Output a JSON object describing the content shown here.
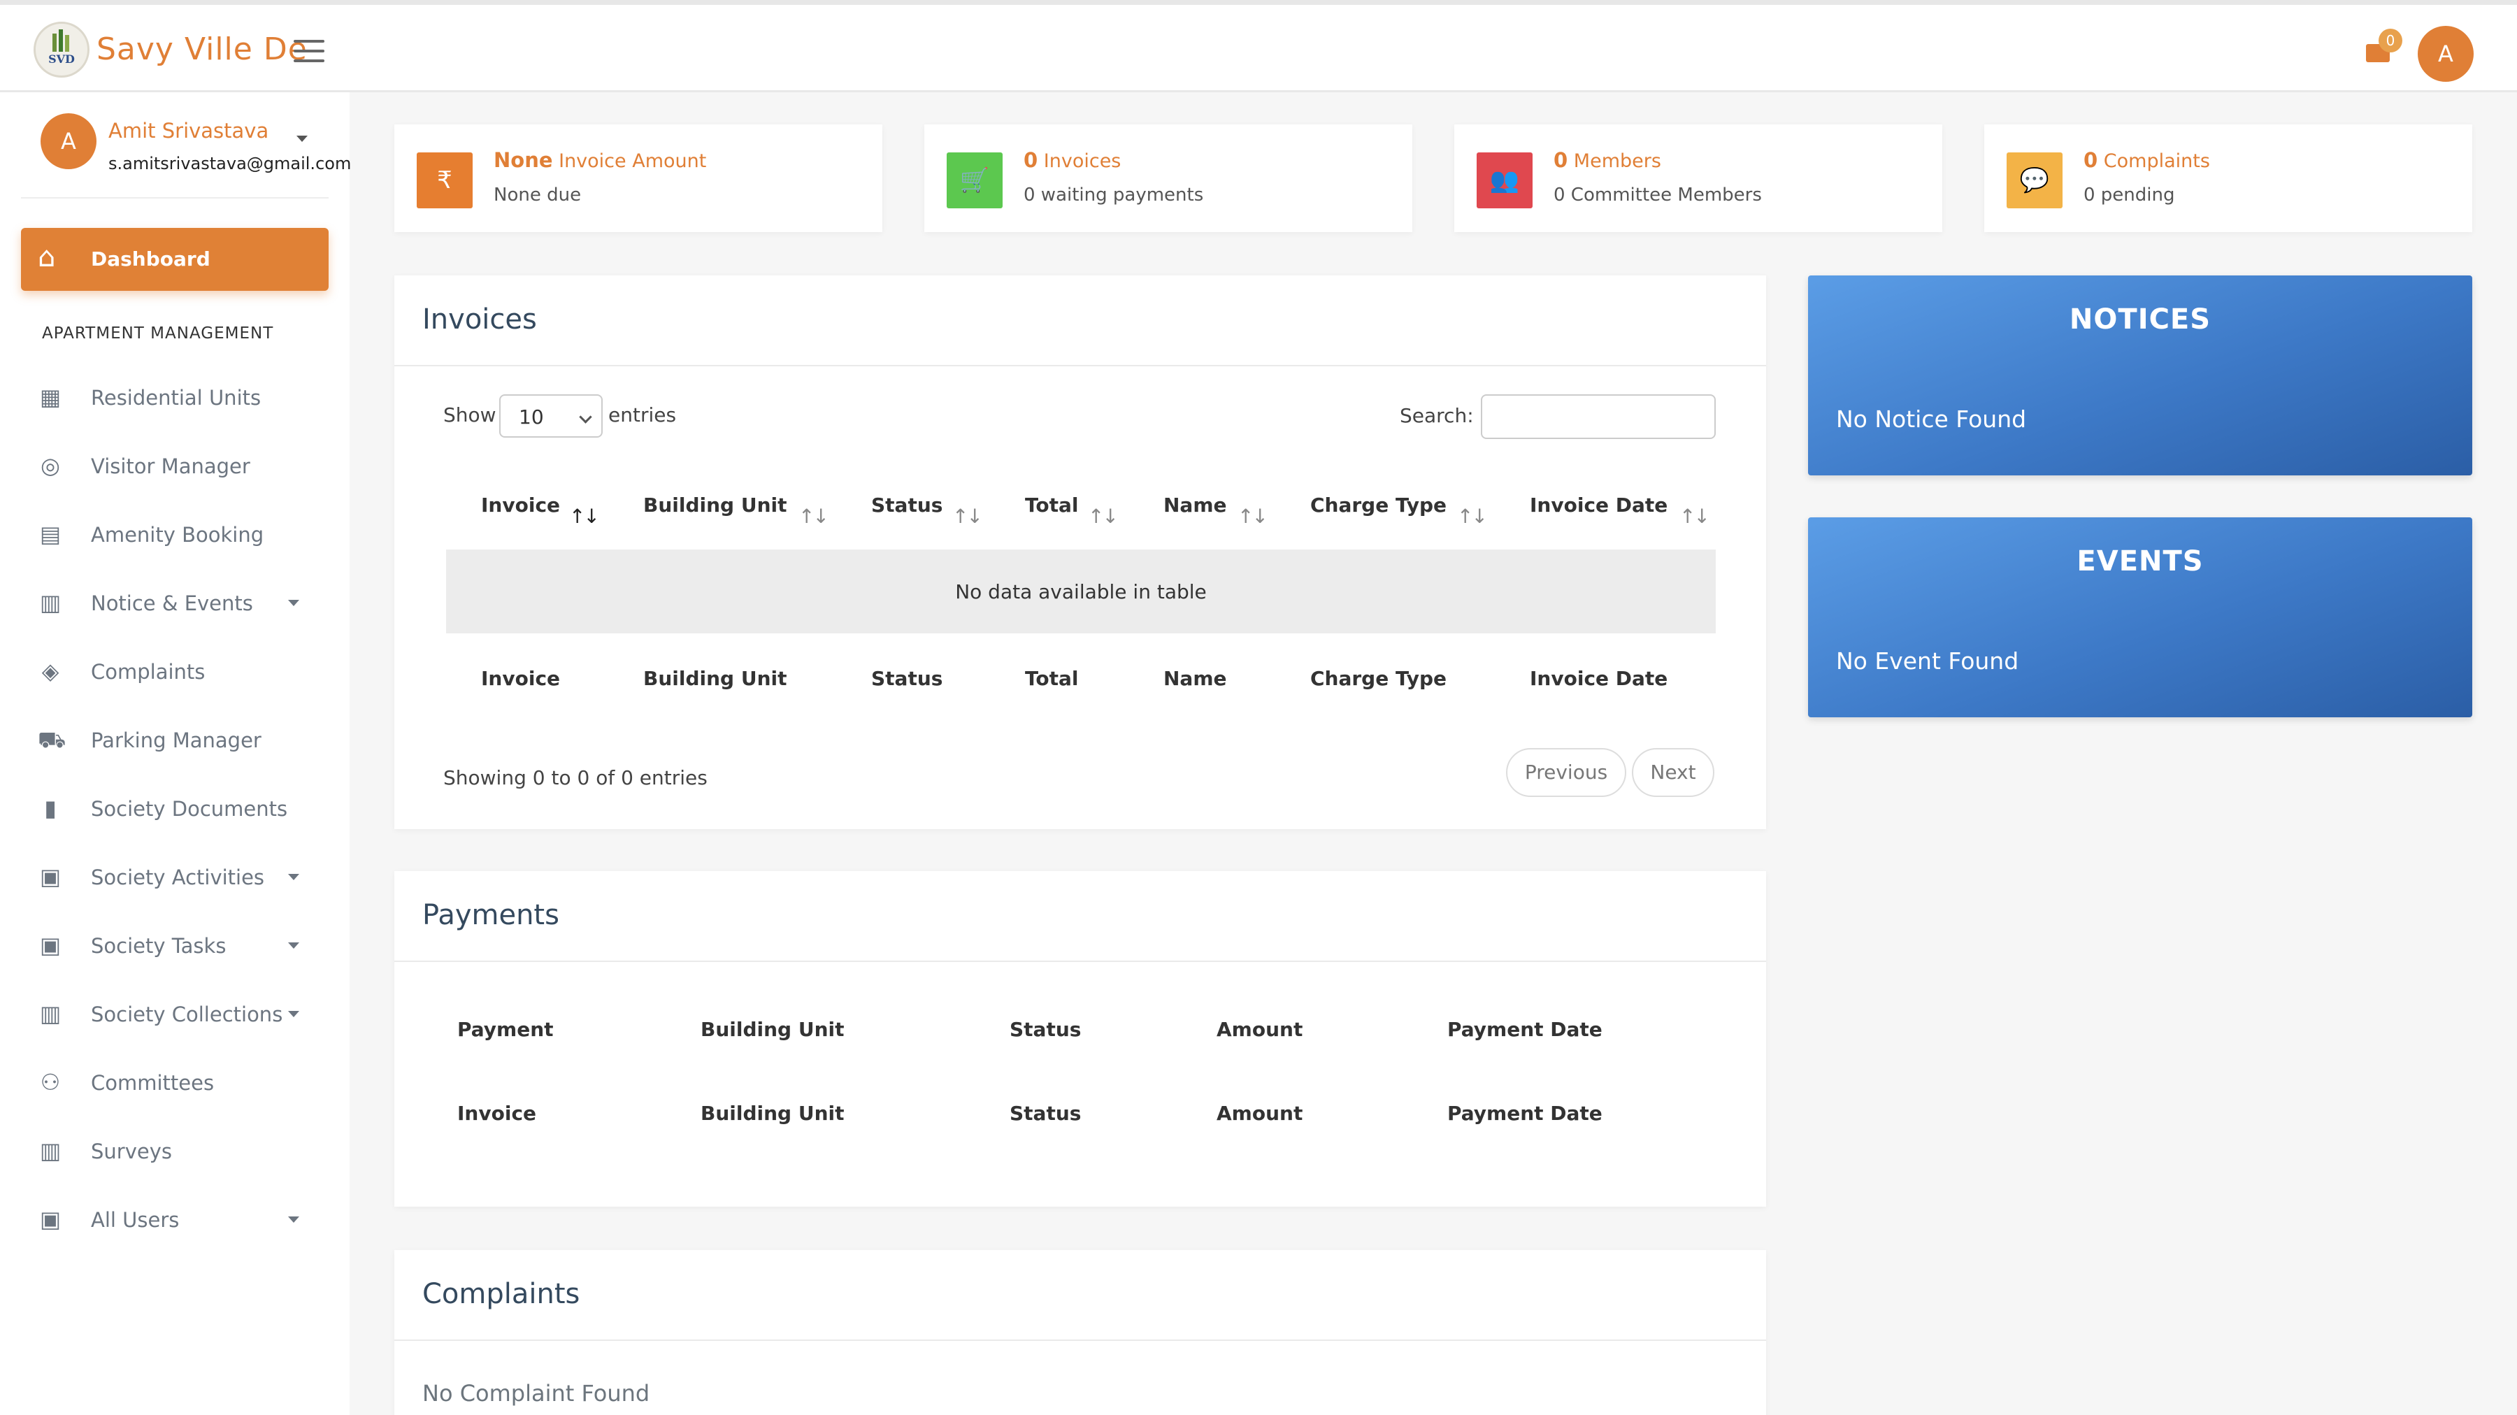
{
  "app": {
    "title": "Savy Ville De",
    "logo_text": "SVD"
  },
  "header": {
    "mail_badge": "0",
    "avatar_initial": "A"
  },
  "user": {
    "initial": "A",
    "name": "Amit Srivastava",
    "email": "s.amitsrivastava@gmail.com"
  },
  "sidebar": {
    "dashboard_label": "Dashboard",
    "section_label": "APARTMENT MANAGEMENT",
    "items": [
      {
        "label": "Residential Units",
        "icon": "building-icon",
        "glyph": "▦",
        "caret": false
      },
      {
        "label": "Visitor Manager",
        "icon": "fingerprint-icon",
        "glyph": "◎",
        "caret": false
      },
      {
        "label": "Amenity Booking",
        "icon": "book-icon",
        "glyph": "▤",
        "caret": false
      },
      {
        "label": "Notice & Events",
        "icon": "clipboard-icon",
        "glyph": "▥",
        "caret": true
      },
      {
        "label": "Complaints",
        "icon": "layers-icon",
        "glyph": "◈",
        "caret": false
      },
      {
        "label": "Parking Manager",
        "icon": "car-icon",
        "glyph": "⛟",
        "caret": false
      },
      {
        "label": "Society Documents",
        "icon": "file-icon",
        "glyph": "▮",
        "caret": false
      },
      {
        "label": "Society Activities",
        "icon": "contact-card-icon",
        "glyph": "▣",
        "caret": true
      },
      {
        "label": "Society Tasks",
        "icon": "contact-card-icon",
        "glyph": "▣",
        "caret": true
      },
      {
        "label": "Society Collections",
        "icon": "clipboard-icon",
        "glyph": "▥",
        "caret": true
      },
      {
        "label": "Committees",
        "icon": "users-cog-icon",
        "glyph": "⚇",
        "caret": false
      },
      {
        "label": "Surveys",
        "icon": "clipboard-icon",
        "glyph": "▥",
        "caret": false
      },
      {
        "label": "All Users",
        "icon": "contact-card-icon",
        "glyph": "▣",
        "caret": true
      }
    ]
  },
  "stats": [
    {
      "value": "None",
      "label": "Invoice Amount",
      "sub": "None due",
      "color": "#e67e30",
      "icon": "rupee-icon",
      "glyph": "₹"
    },
    {
      "value": "0",
      "label": "Invoices",
      "sub": "0 waiting payments",
      "color": "#5cc84f",
      "icon": "cart-icon",
      "glyph": "🛒"
    },
    {
      "value": "0",
      "label": "Members",
      "sub": "0 Committee Members",
      "color": "#e0484f",
      "icon": "users-icon",
      "glyph": "👥"
    },
    {
      "value": "0",
      "label": "Complaints",
      "sub": "0 pending",
      "color": "#f3b347",
      "icon": "comment-icon",
      "glyph": "💬"
    }
  ],
  "invoices": {
    "title": "Invoices",
    "show_label": "Show",
    "entries_value": "10",
    "entries_label": "entries",
    "search_label": "Search:",
    "columns": [
      "Invoice",
      "Building Unit",
      "Status",
      "Total",
      "Name",
      "Charge Type",
      "Invoice Date"
    ],
    "sort_glyph": "↑↓",
    "empty_text": "No data available in table",
    "showing_text": "Showing 0 to 0 of 0 entries",
    "prev_label": "Previous",
    "next_label": "Next"
  },
  "payments": {
    "title": "Payments",
    "header_columns": [
      "Payment",
      "Building Unit",
      "Status",
      "Amount",
      "Payment Date"
    ],
    "footer_columns": [
      "Invoice",
      "Building Unit",
      "Status",
      "Amount",
      "Payment Date"
    ]
  },
  "complaints": {
    "title": "Complaints",
    "empty_text": "No Complaint Found"
  },
  "notices": {
    "title": "NOTICES",
    "empty_text": "No Notice Found"
  },
  "events": {
    "title": "EVENTS",
    "empty_text": "No Event Found"
  },
  "colors": {
    "accent": "#e07f36",
    "box_blue": "#3d79c7"
  }
}
